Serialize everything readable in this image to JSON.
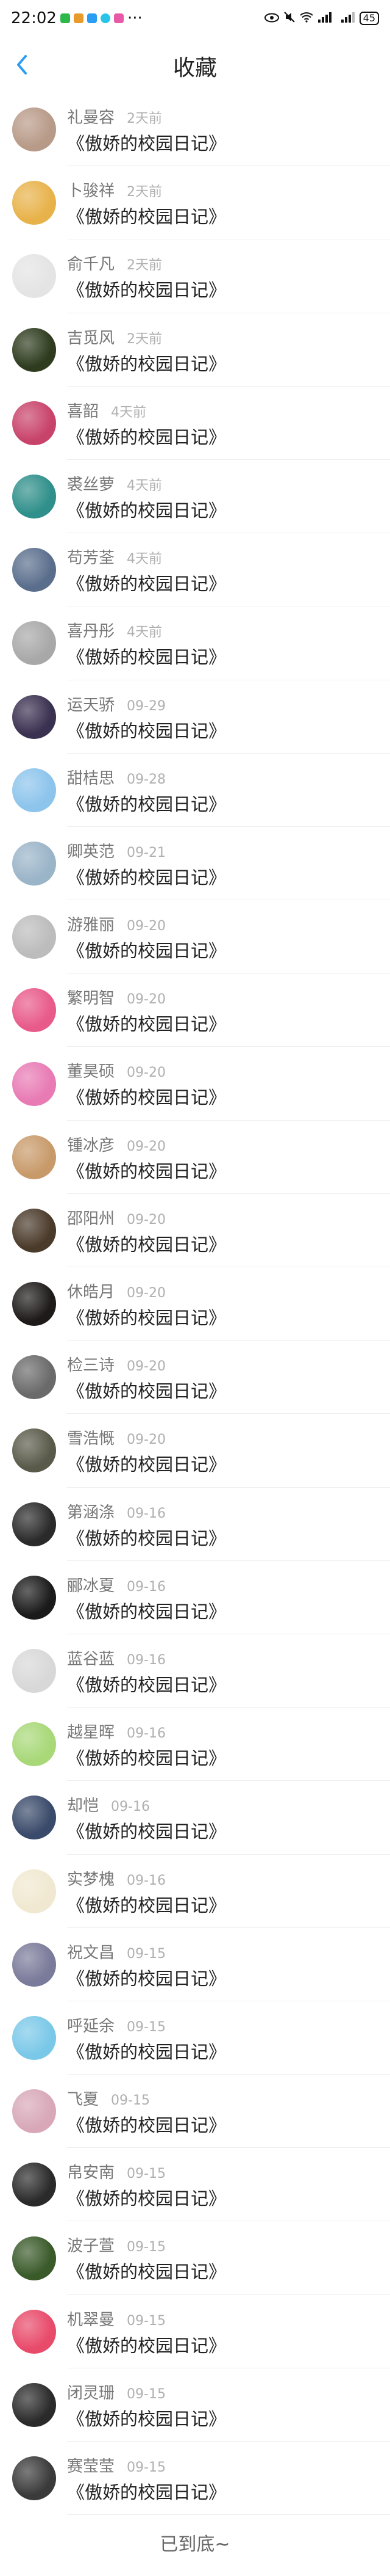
{
  "status_bar": {
    "time": "22:02",
    "dots": "···",
    "battery": "45"
  },
  "header": {
    "title": "收藏"
  },
  "items": [
    {
      "name": "礼曼容",
      "time": "2天前",
      "book": "《傲娇的校园日记》",
      "avatar_color": "#b89a88"
    },
    {
      "name": "卜骏祥",
      "time": "2天前",
      "book": "《傲娇的校园日记》",
      "avatar_color": "#e8b24a"
    },
    {
      "name": "俞千凡",
      "time": "2天前",
      "book": "《傲娇的校园日记》",
      "avatar_color": "#e4e4e4"
    },
    {
      "name": "吉觅风",
      "time": "2天前",
      "book": "《傲娇的校园日记》",
      "avatar_color": "#2e3b1e"
    },
    {
      "name": "喜韶",
      "time": "4天前",
      "book": "《傲娇的校园日记》",
      "avatar_color": "#c8436a"
    },
    {
      "name": "裘丝萝",
      "time": "4天前",
      "book": "《傲娇的校园日记》",
      "avatar_color": "#2f8f8a"
    },
    {
      "name": "苟芳荃",
      "time": "4天前",
      "book": "《傲娇的校园日记》",
      "avatar_color": "#5a6e8c"
    },
    {
      "name": "喜丹彤",
      "time": "4天前",
      "book": "《傲娇的校园日记》",
      "avatar_color": "#a8a8a8"
    },
    {
      "name": "运天骄",
      "time": "09-29",
      "book": "《傲娇的校园日记》",
      "avatar_color": "#3a3050"
    },
    {
      "name": "甜桔思",
      "time": "09-28",
      "book": "《傲娇的校园日记》",
      "avatar_color": "#8cc4ec"
    },
    {
      "name": "卿英范",
      "time": "09-21",
      "book": "《傲娇的校园日记》",
      "avatar_color": "#9ab4c8"
    },
    {
      "name": "游雅丽",
      "time": "09-20",
      "book": "《傲娇的校园日记》",
      "avatar_color": "#bcbcbc"
    },
    {
      "name": "繁明智",
      "time": "09-20",
      "book": "《傲娇的校园日记》",
      "avatar_color": "#e85a8a"
    },
    {
      "name": "董昊硕",
      "time": "09-20",
      "book": "《傲娇的校园日记》",
      "avatar_color": "#e87ab4"
    },
    {
      "name": "锺冰彦",
      "time": "09-20",
      "book": "《傲娇的校园日记》",
      "avatar_color": "#c89a6a"
    },
    {
      "name": "邵阳州",
      "time": "09-20",
      "book": "《傲娇的校园日记》",
      "avatar_color": "#4a3a2a"
    },
    {
      "name": "休皓月",
      "time": "09-20",
      "book": "《傲娇的校园日记》",
      "avatar_color": "#1e1a1a"
    },
    {
      "name": "检三诗",
      "time": "09-20",
      "book": "《傲娇的校园日记》",
      "avatar_color": "#6a6a6a"
    },
    {
      "name": "雪浩慨",
      "time": "09-20",
      "book": "《傲娇的校园日记》",
      "avatar_color": "#5a5a4a"
    },
    {
      "name": "第涵涤",
      "time": "09-16",
      "book": "《傲娇的校园日记》",
      "avatar_color": "#2a2a2a"
    },
    {
      "name": "郦冰夏",
      "time": "09-16",
      "book": "《傲娇的校园日记》",
      "avatar_color": "#1a1a1a"
    },
    {
      "name": "蓝谷蓝",
      "time": "09-16",
      "book": "《傲娇的校园日记》",
      "avatar_color": "#d8d8d8"
    },
    {
      "name": "越星晖",
      "time": "09-16",
      "book": "《傲娇的校园日记》",
      "avatar_color": "#a8d878"
    },
    {
      "name": "却恺",
      "time": "09-16",
      "book": "《傲娇的校园日记》",
      "avatar_color": "#3a4a6a"
    },
    {
      "name": "实梦槐",
      "time": "09-16",
      "book": "《傲娇的校园日记》",
      "avatar_color": "#f0e8d0"
    },
    {
      "name": "祝文昌",
      "time": "09-15",
      "book": "《傲娇的校园日记》",
      "avatar_color": "#7a7a9a"
    },
    {
      "name": "呼延余",
      "time": "09-15",
      "book": "《傲娇的校园日记》",
      "avatar_color": "#7ac8e8"
    },
    {
      "name": "飞夏",
      "time": "09-15",
      "book": "《傲娇的校园日记》",
      "avatar_color": "#d8a8b8"
    },
    {
      "name": "帛安南",
      "time": "09-15",
      "book": "《傲娇的校园日记》",
      "avatar_color": "#2a2a2a"
    },
    {
      "name": "波子萱",
      "time": "09-15",
      "book": "《傲娇的校园日记》",
      "avatar_color": "#3a5a2a"
    },
    {
      "name": "机翠曼",
      "time": "09-15",
      "book": "《傲娇的校园日记》",
      "avatar_color": "#e84a6a"
    },
    {
      "name": "闭灵珊",
      "time": "09-15",
      "book": "《傲娇的校园日记》",
      "avatar_color": "#2a2a2a"
    },
    {
      "name": "赛莹莹",
      "time": "09-15",
      "book": "《傲娇的校园日记》",
      "avatar_color": "#3a3a3a"
    }
  ],
  "footer": {
    "end_text": "已到底~"
  },
  "colors": {
    "accent": "#2a9df4",
    "divider": "#eeeeee",
    "meta_gray": "#777777"
  }
}
